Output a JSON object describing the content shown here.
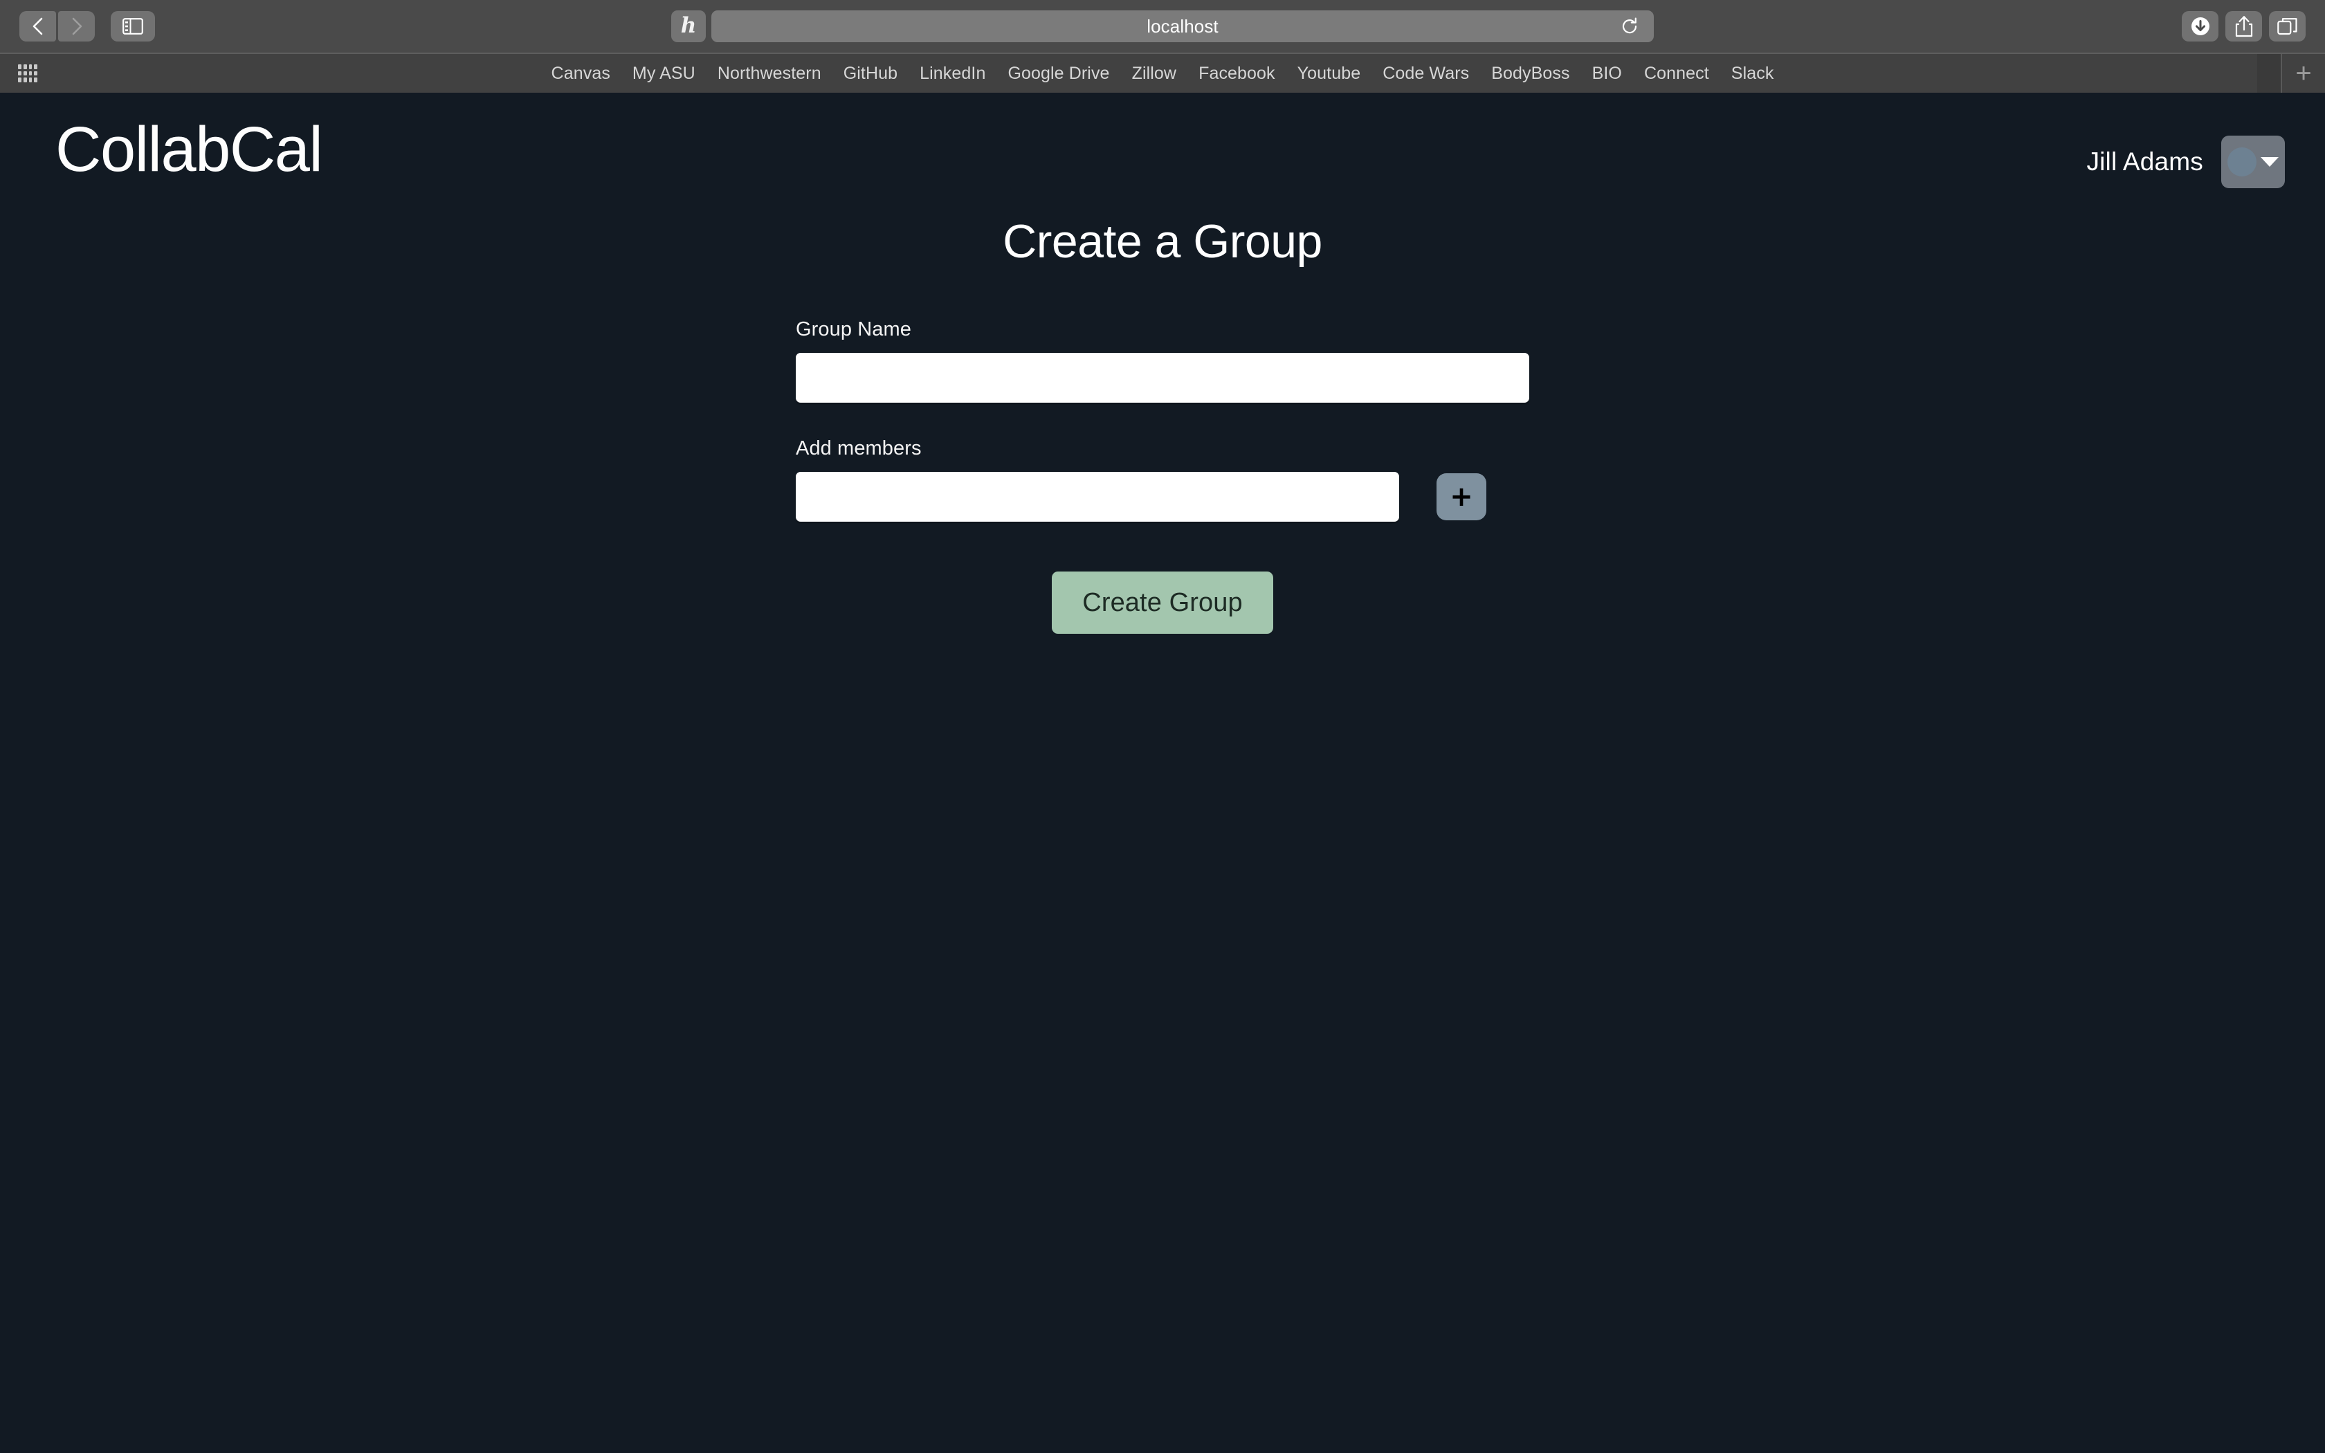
{
  "browser": {
    "nav": {
      "back_icon": "chevron-left-icon",
      "forward_icon": "chevron-right-icon",
      "sidebar_icon": "sidebar-toggle-icon"
    },
    "extension_button_glyph": "h",
    "url": "localhost",
    "reload_icon": "reload-icon",
    "downloads_icon": "downloads-icon",
    "share_icon": "share-icon",
    "tabs_overview_icon": "tab-overview-icon",
    "apps_grid_icon": "apps-grid-icon",
    "new_tab_label": "+",
    "bookmarks": [
      "Canvas",
      "My ASU",
      "Northwestern",
      "GitHub",
      "LinkedIn",
      "Google Drive",
      "Zillow",
      "Facebook",
      "Youtube",
      "Code Wars",
      "BodyBoss",
      "BIO",
      "Connect",
      "Slack"
    ]
  },
  "app": {
    "brand": "CollabCal",
    "user": {
      "name": "Jill Adams",
      "avatar_icon": "avatar-circle-icon",
      "chevron_icon": "chevron-down-icon"
    },
    "page_title": "Create a Group",
    "form": {
      "group_name": {
        "label": "Group Name",
        "value": "",
        "placeholder": ""
      },
      "add_members": {
        "label": "Add members",
        "value": "",
        "placeholder": "",
        "add_button_glyph": "+",
        "add_button_icon": "plus-icon"
      },
      "submit_label": "Create Group"
    }
  },
  "colors": {
    "page_background": "#121a23",
    "accent_green": "#a3c6ae",
    "accent_slate": "#7f919f",
    "profile_button": "#6f767f",
    "avatar": "#6d8192",
    "chrome": "#4a4a4a",
    "bookmarks_bar": "#414141"
  }
}
